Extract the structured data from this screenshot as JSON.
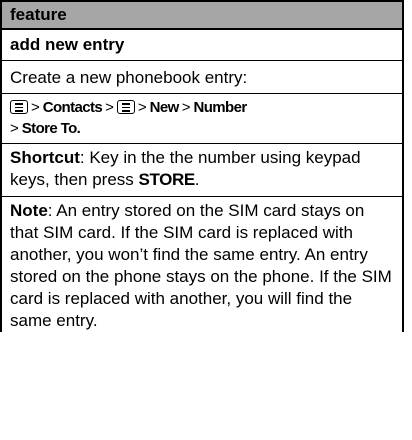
{
  "table": {
    "header": "feature",
    "title": "add new entry",
    "intro": "Create a new phonebook entry:",
    "path": {
      "separator": ">",
      "icon": "menu-key-icon",
      "items": [
        "Contacts",
        "New",
        "Number",
        "Store To."
      ]
    },
    "shortcut": {
      "label": "Shortcut",
      "text_before": ": Key in the the number using keypad keys, then press ",
      "key": "STORE",
      "text_after": "."
    },
    "note": {
      "label": "Note",
      "text": ": An entry stored on the SIM card stays on that SIM card. If the SIM card is replaced with another, you won’t find the same entry. An entry stored on the phone stays on the phone. If the SIM card is replaced with another, you will find the same entry."
    }
  }
}
